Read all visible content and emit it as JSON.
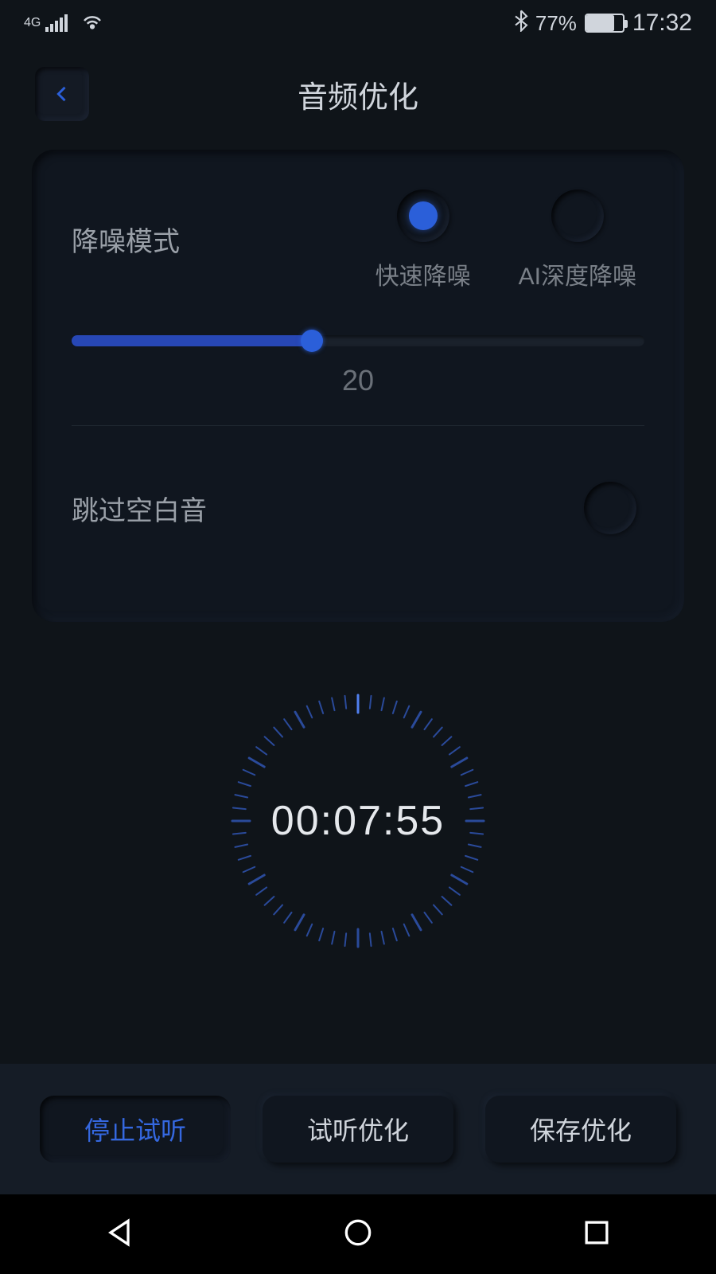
{
  "status": {
    "network": "4G",
    "bluetooth_icon": "bluetooth",
    "battery_pct": "77%",
    "time": "17:32"
  },
  "header": {
    "title": "音频优化"
  },
  "noise": {
    "label": "降噪模式",
    "option1": "快速降噪",
    "option2": "AI深度降噪",
    "selected": "option1",
    "slider_value": "20",
    "slider_pct": 42
  },
  "skip": {
    "label": "跳过空白音",
    "enabled": false
  },
  "timer": {
    "value": "00:07:55"
  },
  "buttons": {
    "stop": "停止试听",
    "preview": "试听优化",
    "save": "保存优化"
  }
}
